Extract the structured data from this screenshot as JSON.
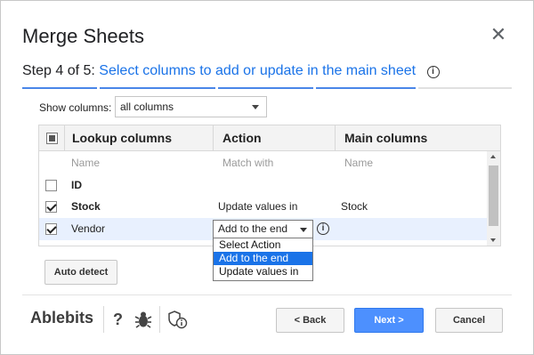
{
  "dialog": {
    "title": "Merge Sheets",
    "close_icon": "close-icon"
  },
  "step": {
    "number": "Step 4 of 5:",
    "description": "Select columns to add or update in the main sheet",
    "info_glyph": "i",
    "accent_color": "#1a73e8"
  },
  "show_columns": {
    "label": "Show columns:",
    "value": "all columns"
  },
  "table": {
    "headers": {
      "lookup": "Lookup columns",
      "action": "Action",
      "main": "Main columns"
    },
    "subheaders": {
      "lookup": "Name",
      "action": "Match with",
      "main": "Name"
    },
    "rows": [
      {
        "checked": false,
        "lookup": "ID",
        "action": "",
        "main": ""
      },
      {
        "checked": true,
        "lookup": "Stock",
        "action": "Update values in",
        "main": "Stock"
      },
      {
        "checked": true,
        "lookup": "Vendor",
        "action": "Add to the end",
        "main": ""
      }
    ]
  },
  "action_dropdown": {
    "selected": "Add to the end",
    "options": [
      "Select Action",
      "Add to the end",
      "Update values in"
    ]
  },
  "buttons": {
    "auto_detect": "Auto detect",
    "back": "< Back",
    "next": "Next >",
    "cancel": "Cancel",
    "next_color": "#4d90fe"
  },
  "footer": {
    "brand": "Ablebits",
    "help": "?",
    "icons": [
      "help-icon",
      "bug-icon",
      "privacy-shield-icon"
    ]
  }
}
